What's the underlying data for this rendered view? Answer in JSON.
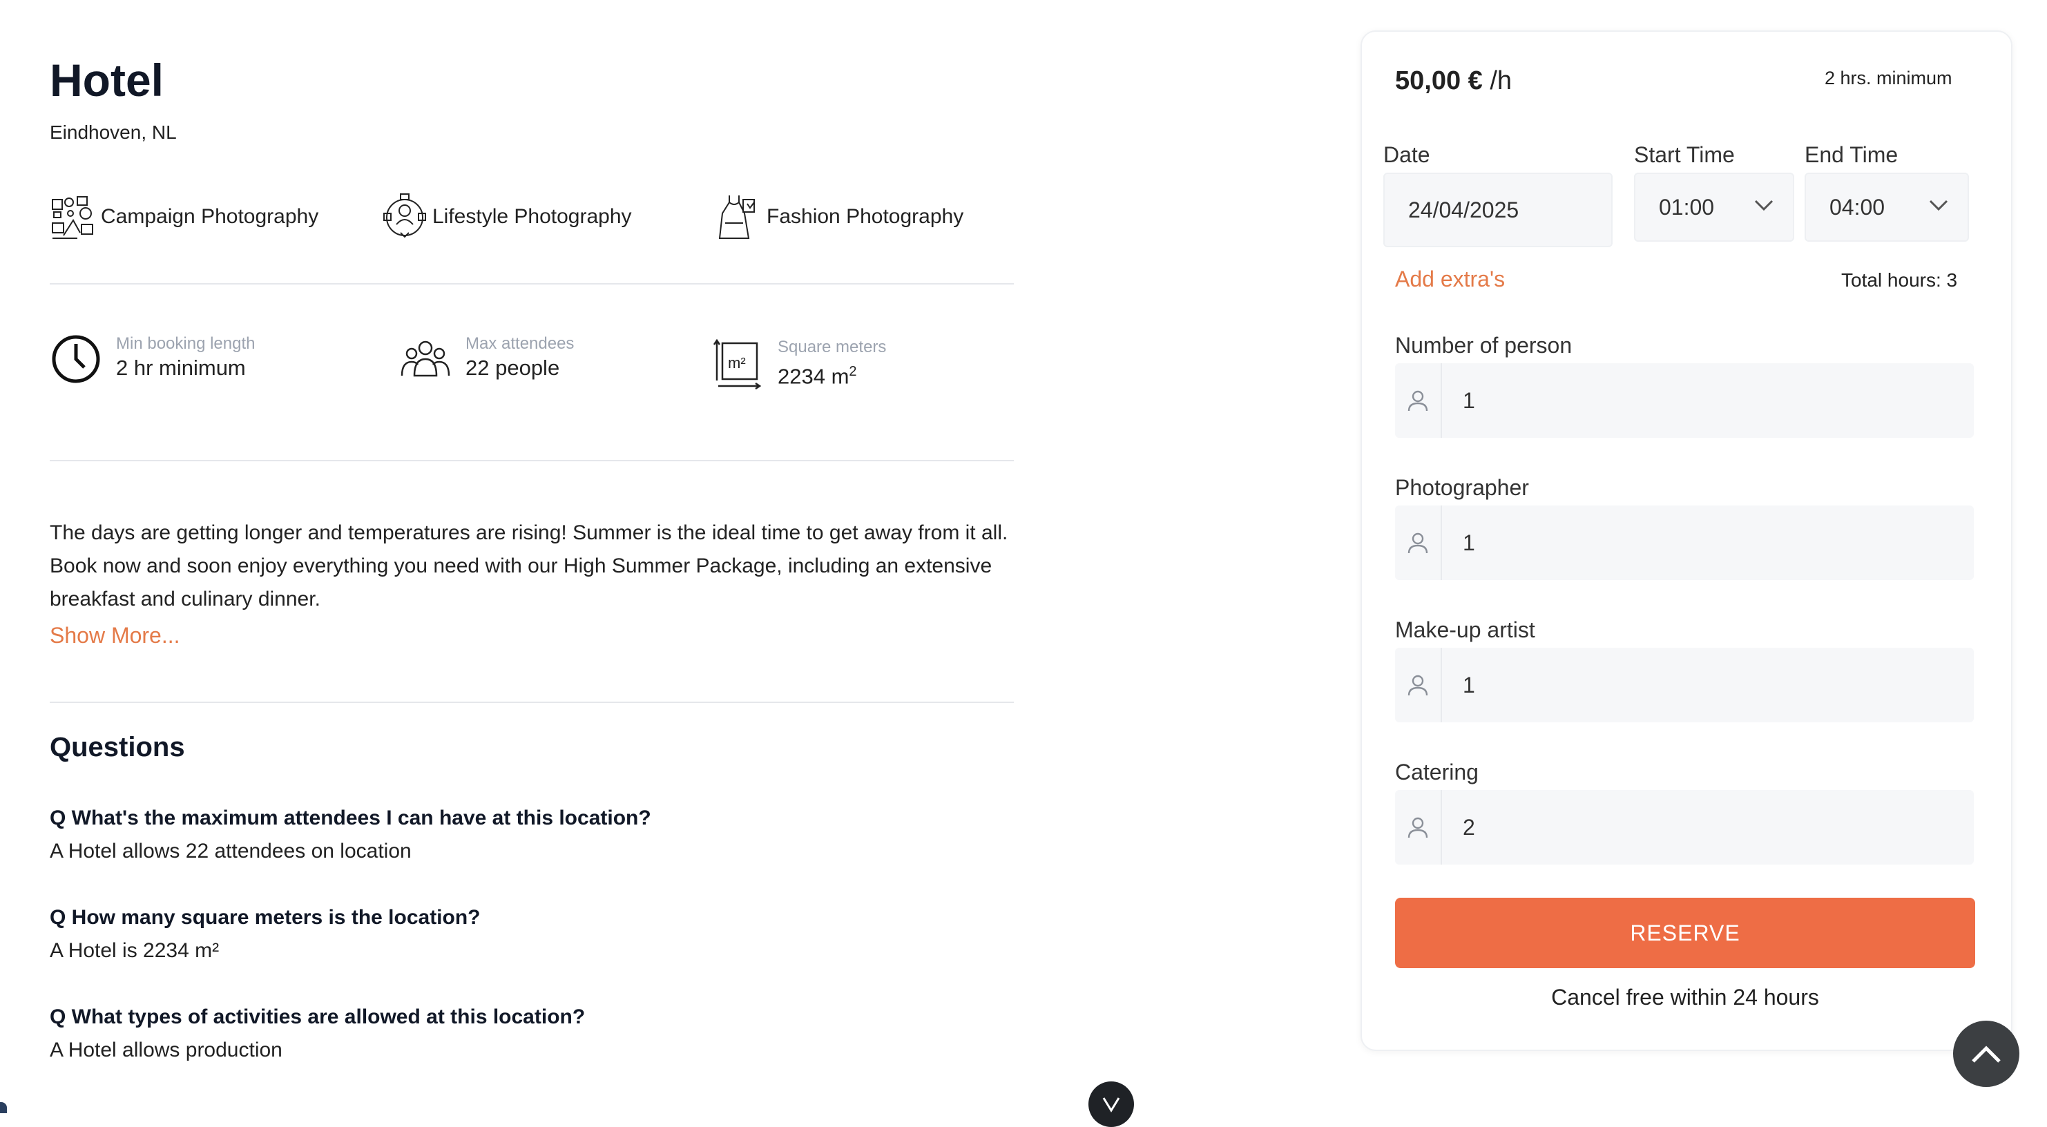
{
  "listing": {
    "title": "Hotel",
    "location": "Eindhoven, NL",
    "categories": [
      {
        "label": "Campaign Photography",
        "icon": "campaign-photography-icon"
      },
      {
        "label": "Lifestyle Photography",
        "icon": "lifestyle-photography-icon"
      },
      {
        "label": "Fashion Photography",
        "icon": "fashion-photography-icon"
      }
    ],
    "stats": [
      {
        "label": "Min booking length",
        "value": "2 hr minimum",
        "icon": "clock-icon"
      },
      {
        "label": "Max attendees",
        "value": "22 people",
        "icon": "people-icon"
      },
      {
        "label": "Square meters",
        "value": "2234 m",
        "value_sup": "2",
        "icon": "square-meters-icon"
      }
    ],
    "description": "The days are getting longer and temperatures are rising! Summer is the ideal time to get away from it all. Book now and soon enjoy everything you need with our High Summer Package, including an extensive breakfast and culinary dinner.",
    "show_more": "Show More..."
  },
  "questions": {
    "heading": "Questions",
    "items": [
      {
        "q": "Q What's the maximum attendees I can have at this location?",
        "a": "A Hotel allows 22 attendees on location"
      },
      {
        "q": "Q How many square meters is the location?",
        "a": "A Hotel is 2234 m²"
      },
      {
        "q": "Q What types of activities are allowed at this location?",
        "a": "A Hotel allows production"
      }
    ]
  },
  "booking": {
    "price": "50,00 €",
    "price_unit": "/h",
    "minimum": "2 hrs. minimum",
    "date_label": "Date",
    "date_value": "24/04/2025",
    "start_label": "Start Time",
    "start_value": "01:00",
    "end_label": "End Time",
    "end_value": "04:00",
    "add_extras": "Add extra's",
    "total_hours": "Total hours: 3",
    "extras": [
      {
        "label": "Number of person",
        "value": "1"
      },
      {
        "label": "Photographer",
        "value": "1"
      },
      {
        "label": "Make-up artist",
        "value": "1"
      },
      {
        "label": "Catering",
        "value": "2"
      }
    ],
    "reserve_label": "RESERVE",
    "cancel_note": "Cancel free within 24 hours"
  },
  "colors": {
    "accent": "#ee6d45",
    "link": "#e47a48",
    "field_bg": "#f6f7f9"
  }
}
